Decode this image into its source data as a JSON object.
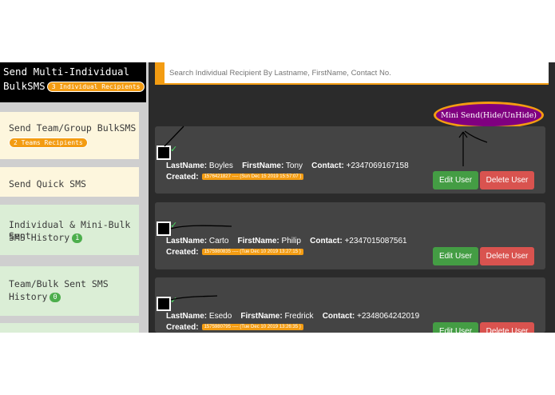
{
  "sidebar": {
    "active": {
      "line1": "Send Multi-Individual",
      "line2": "BulkSMS",
      "badge": "3 Individual Recipients"
    },
    "items": [
      {
        "label": "Send Team/Group BulkSMS",
        "badge": "2 Teams Recipients"
      },
      {
        "label": "Send Quick SMS"
      },
      {
        "label1": "Individual & Mini-Bulk Sent",
        "label2": "SMS History",
        "badge": "1"
      },
      {
        "label1": "Team/Bulk Sent SMS",
        "label2": "History",
        "badge": "0"
      }
    ]
  },
  "search": {
    "placeholder": "Search Individual Recipient By Lastname, FirstName, Contact No."
  },
  "mini_send": {
    "label": "Mini Send(Hide/UnHide)"
  },
  "recipient_labels": {
    "lastname": "LastName:",
    "firstname": "FirstName:",
    "contact": "Contact:",
    "created": "Created:",
    "tick": "✓"
  },
  "recipients": [
    {
      "lastname": "Boyles",
      "firstname": "Tony",
      "contact": "+2347069167158",
      "created": "1576421827 ---- (Sun Dec 15 2019 15:57:07 )",
      "edit": "Edit User",
      "delete": "Delete User"
    },
    {
      "lastname": "Carto",
      "firstname": "Philip",
      "contact": "+2347015087561",
      "created": "1575980835 ---- (Tue Dec 10 2019 13:27:15 )",
      "edit": "Edit User",
      "delete": "Delete User"
    },
    {
      "lastname": "Esedo",
      "firstname": "Fredrick",
      "contact": "+2348064242019",
      "created": "1575980795 ---- (Tue Dec 10 2019 13:26:35 )",
      "edit": "Edit User",
      "delete": "Delete User"
    }
  ],
  "colors": {
    "accent": "#f39c12",
    "mini_send": "#800080",
    "edit": "#449d44",
    "delete": "#d9534f"
  }
}
